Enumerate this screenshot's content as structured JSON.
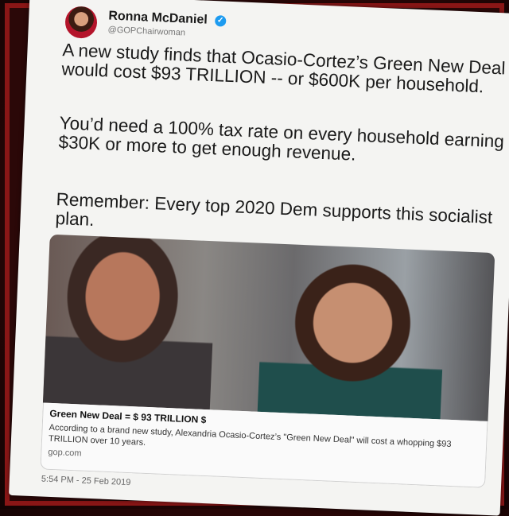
{
  "tweet": {
    "author": {
      "name": "Ronna McDaniel",
      "handle": "@GOPChairwoman",
      "verified_icon": "✓"
    },
    "paragraphs": [
      "A new study finds that Ocasio-Cortez’s Green New Deal would cost $93 TRILLION -- or $600K per household.",
      "You’d need a 100% tax rate on every household earning $30K or more to get enough revenue.",
      "Remember: Every top 2020 Dem supports this socialist plan."
    ],
    "link_card": {
      "title": "Green New Deal = $ 93 TRILLION $",
      "description": "According to a brand new study, Alexandria Ocasio-Cortez’s \"Green New Deal\" will cost a whopping $93 TRILLION over 10 years.",
      "domain": "gop.com"
    },
    "timestamp": "5:54 PM - 25 Feb 2019"
  },
  "colors": {
    "frame": "#8a1616",
    "background": "#2b0808",
    "verified": "#1d9bf0"
  }
}
